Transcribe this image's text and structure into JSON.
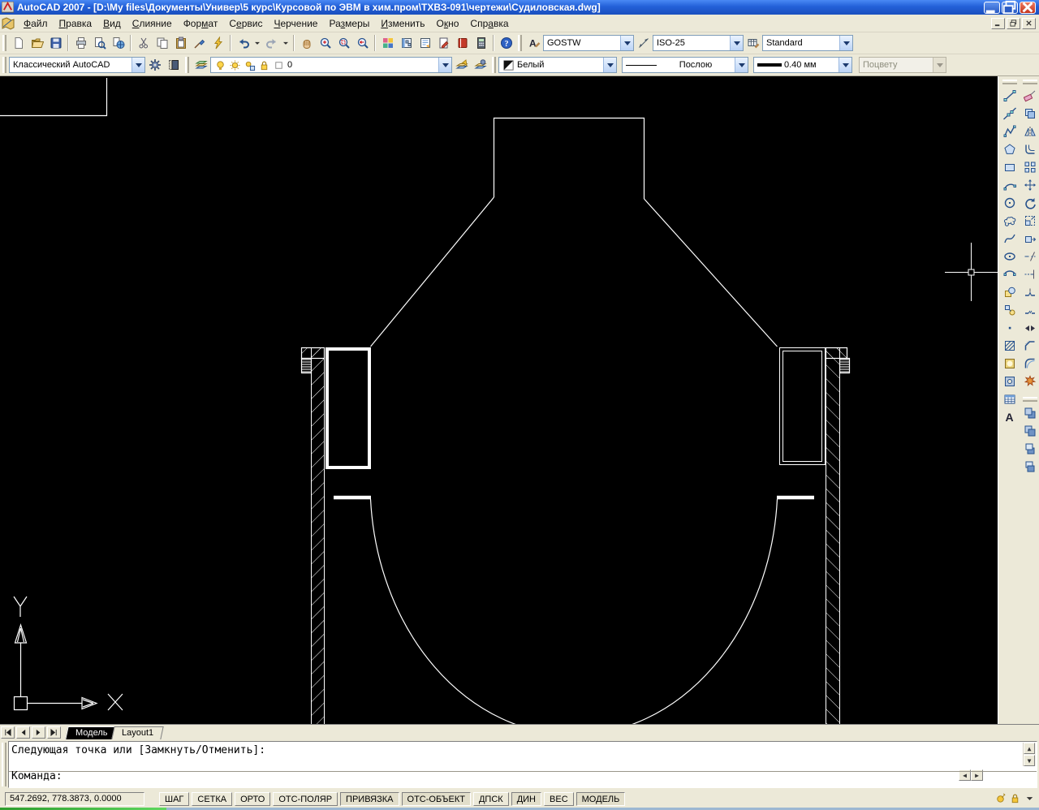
{
  "colors": {
    "titlebar": "#2360d8",
    "toolbar_bg": "#ece9d8",
    "canvas_bg": "#000000",
    "line_color": "#ffffff",
    "active_tab_bg": "#000000"
  },
  "window": {
    "title": "AutoCAD 2007 - [D:\\My files\\Документы\\Универ\\5 курс\\Курсовой по ЭВМ в хим.пром\\ТХВЗ-091\\чертежи\\Судиловская.dwg]"
  },
  "menu": {
    "items": [
      {
        "label": "Файл",
        "u": 0
      },
      {
        "label": "Правка",
        "u": 0
      },
      {
        "label": "Вид",
        "u": 0
      },
      {
        "label": "Слияние",
        "u": 0
      },
      {
        "label": "Формат",
        "u": 3
      },
      {
        "label": "Сервис",
        "u": 1
      },
      {
        "label": "Черчение",
        "u": 0
      },
      {
        "label": "Размеры",
        "u": 2
      },
      {
        "label": "Изменить",
        "u": 0
      },
      {
        "label": "Окно",
        "u": 1
      },
      {
        "label": "Справка",
        "u": 3
      }
    ]
  },
  "toolbars": {
    "standard": [
      {
        "i": "std_new",
        "n": "new"
      },
      {
        "i": "std_open",
        "n": "open"
      },
      {
        "i": "std_save",
        "n": "save"
      },
      {
        "sep": true
      },
      {
        "i": "std_plot",
        "n": "plot"
      },
      {
        "i": "std_preview",
        "n": "plot-preview"
      },
      {
        "i": "std_publish",
        "n": "publish"
      },
      {
        "sep": true
      },
      {
        "i": "std_cut",
        "n": "cut"
      },
      {
        "i": "std_copy",
        "n": "copy-clip"
      },
      {
        "i": "std_paste",
        "n": "paste"
      },
      {
        "i": "std_matchprops",
        "n": "match-properties"
      },
      {
        "i": "std_blockeditor",
        "n": "block-editor"
      },
      {
        "sep": true
      },
      {
        "i": "std_undo",
        "n": "undo"
      },
      {
        "i": "drop",
        "n": "undo-list",
        "narrow": true
      },
      {
        "i": "std_redo",
        "n": "redo"
      },
      {
        "i": "drop",
        "n": "redo-list",
        "narrow": true
      },
      {
        "sep": true
      },
      {
        "i": "std_pan",
        "n": "pan"
      },
      {
        "i": "std_zoom_rt",
        "n": "zoom-realtime"
      },
      {
        "i": "std_zoom_win",
        "n": "zoom-window"
      },
      {
        "i": "std_zoom_prev",
        "n": "zoom-previous"
      },
      {
        "sep": true
      },
      {
        "i": "std_designcenter",
        "n": "designcenter"
      },
      {
        "i": "std_toolpalettes",
        "n": "tool-palettes"
      },
      {
        "i": "std_sheetset",
        "n": "sheet-set-manager"
      },
      {
        "i": "std_markup",
        "n": "markup-set-manager"
      },
      {
        "i": "std_etransmit",
        "n": "etransmit"
      },
      {
        "i": "std_quickcalc",
        "n": "quickcalc"
      },
      {
        "sep": true
      },
      {
        "i": "std_help",
        "n": "help"
      }
    ],
    "styles": {
      "text_style_value": "GOSTW",
      "dim_style_value": "ISO-25",
      "table_style_value": "Standard"
    },
    "workspace": {
      "value": "Классический AutoCAD"
    },
    "layers": {
      "current_layer": "0"
    },
    "properties": {
      "color_value": "Белый",
      "linetype_value": "Послою",
      "lineweight_value": "0.40 мм",
      "plot_style_value": "Поцвету"
    }
  },
  "right_toolbars": {
    "draw": [
      {
        "i": "d_line",
        "n": "line"
      },
      {
        "i": "d_xline",
        "n": "construction-line"
      },
      {
        "i": "d_pline",
        "n": "polyline"
      },
      {
        "i": "d_polygon",
        "n": "polygon"
      },
      {
        "i": "d_rect",
        "n": "rectangle"
      },
      {
        "i": "d_arc",
        "n": "arc"
      },
      {
        "i": "d_circle",
        "n": "circle"
      },
      {
        "i": "d_revcloud",
        "n": "revision-cloud"
      },
      {
        "i": "d_spline",
        "n": "spline"
      },
      {
        "i": "d_ellipse",
        "n": "ellipse"
      },
      {
        "i": "d_ellipsearc",
        "n": "ellipse-arc"
      },
      {
        "i": "d_insblock",
        "n": "insert-block"
      },
      {
        "i": "d_mkblock",
        "n": "make-block"
      },
      {
        "i": "d_point",
        "n": "point"
      },
      {
        "i": "d_hatch",
        "n": "hatch"
      },
      {
        "i": "d_gradient",
        "n": "gradient"
      },
      {
        "i": "d_region",
        "n": "region"
      },
      {
        "i": "d_table",
        "n": "table"
      },
      {
        "i": "d_mtext",
        "n": "multiline-text"
      }
    ],
    "modify": [
      {
        "i": "m_erase",
        "n": "erase"
      },
      {
        "i": "m_copy",
        "n": "copy-object"
      },
      {
        "i": "m_mirror",
        "n": "mirror"
      },
      {
        "i": "m_offset",
        "n": "offset"
      },
      {
        "i": "m_array",
        "n": "array"
      },
      {
        "i": "m_move",
        "n": "move"
      },
      {
        "i": "m_rotate",
        "n": "rotate"
      },
      {
        "i": "m_scale",
        "n": "scale"
      },
      {
        "i": "m_stretch",
        "n": "stretch"
      },
      {
        "i": "m_trim",
        "n": "trim"
      },
      {
        "i": "m_extend",
        "n": "extend"
      },
      {
        "i": "m_breakpt",
        "n": "break-at-point"
      },
      {
        "i": "m_break",
        "n": "break"
      },
      {
        "i": "m_join",
        "n": "join"
      },
      {
        "i": "m_chamfer",
        "n": "chamfer"
      },
      {
        "i": "m_fillet",
        "n": "fillet"
      },
      {
        "i": "m_explode",
        "n": "explode"
      }
    ],
    "draw_order": [
      {
        "i": "o_front",
        "n": "bring-to-front"
      },
      {
        "i": "o_back",
        "n": "send-to-back"
      },
      {
        "i": "o_above",
        "n": "bring-above-objects"
      },
      {
        "i": "o_under",
        "n": "send-under-objects"
      }
    ]
  },
  "drawing": {
    "ucs_x_label": "X",
    "ucs_y_label": "Y"
  },
  "layout_tabs": {
    "tabs": [
      {
        "label": "Модель",
        "active": true
      },
      {
        "label": "Layout1",
        "active": false
      }
    ]
  },
  "command_line": {
    "history_line": "Следующая точка или [Замкнуть/Отменить]:",
    "prompt_line": "Команда:"
  },
  "status_bar": {
    "coordinates": "547.2692, 778.3873, 0.0000",
    "toggles": [
      {
        "label": "ШАГ",
        "pressed": false
      },
      {
        "label": "СЕТКА",
        "pressed": false
      },
      {
        "label": "ОРТО",
        "pressed": false
      },
      {
        "label": "ОТС-ПОЛЯР",
        "pressed": false
      },
      {
        "label": "ПРИВЯЗКА",
        "pressed": true
      },
      {
        "label": "ОТС-ОБЪЕКТ",
        "pressed": true
      },
      {
        "label": "ДПСК",
        "pressed": false
      },
      {
        "label": "ДИН",
        "pressed": true
      },
      {
        "label": "ВЕС",
        "pressed": false
      },
      {
        "label": "МОДЕЛЬ",
        "pressed": true
      }
    ],
    "tray": [
      {
        "i": "tray_comm",
        "n": "communication-center-icon"
      },
      {
        "i": "tray_lock",
        "n": "toolbar-lock-icon"
      },
      {
        "i": "drop",
        "n": "status-menu-arrow"
      }
    ]
  }
}
